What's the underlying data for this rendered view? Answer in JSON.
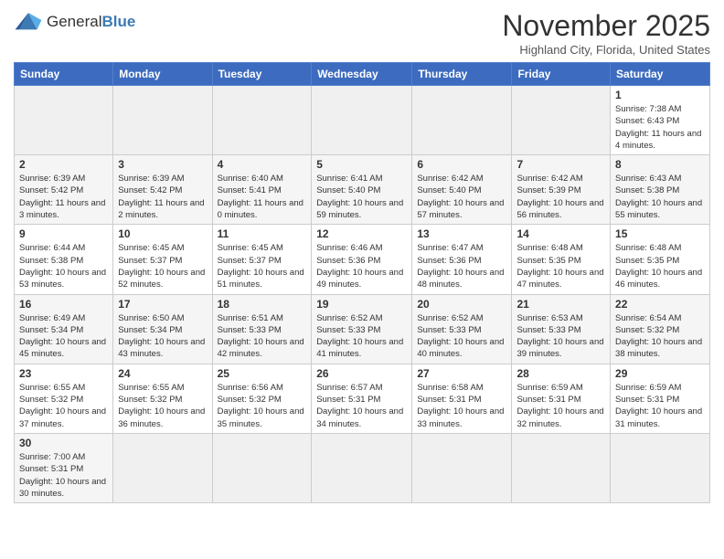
{
  "logo": {
    "text_general": "General",
    "text_blue": "Blue"
  },
  "header": {
    "month": "November 2025",
    "location": "Highland City, Florida, United States"
  },
  "weekdays": [
    "Sunday",
    "Monday",
    "Tuesday",
    "Wednesday",
    "Thursday",
    "Friday",
    "Saturday"
  ],
  "weeks": [
    [
      {
        "day": "",
        "info": ""
      },
      {
        "day": "",
        "info": ""
      },
      {
        "day": "",
        "info": ""
      },
      {
        "day": "",
        "info": ""
      },
      {
        "day": "",
        "info": ""
      },
      {
        "day": "",
        "info": ""
      },
      {
        "day": "1",
        "info": "Sunrise: 7:38 AM\nSunset: 6:43 PM\nDaylight: 11 hours and 4 minutes."
      }
    ],
    [
      {
        "day": "2",
        "info": "Sunrise: 6:39 AM\nSunset: 5:42 PM\nDaylight: 11 hours and 3 minutes."
      },
      {
        "day": "3",
        "info": "Sunrise: 6:39 AM\nSunset: 5:42 PM\nDaylight: 11 hours and 2 minutes."
      },
      {
        "day": "4",
        "info": "Sunrise: 6:40 AM\nSunset: 5:41 PM\nDaylight: 11 hours and 0 minutes."
      },
      {
        "day": "5",
        "info": "Sunrise: 6:41 AM\nSunset: 5:40 PM\nDaylight: 10 hours and 59 minutes."
      },
      {
        "day": "6",
        "info": "Sunrise: 6:42 AM\nSunset: 5:40 PM\nDaylight: 10 hours and 57 minutes."
      },
      {
        "day": "7",
        "info": "Sunrise: 6:42 AM\nSunset: 5:39 PM\nDaylight: 10 hours and 56 minutes."
      },
      {
        "day": "8",
        "info": "Sunrise: 6:43 AM\nSunset: 5:38 PM\nDaylight: 10 hours and 55 minutes."
      }
    ],
    [
      {
        "day": "9",
        "info": "Sunrise: 6:44 AM\nSunset: 5:38 PM\nDaylight: 10 hours and 53 minutes."
      },
      {
        "day": "10",
        "info": "Sunrise: 6:45 AM\nSunset: 5:37 PM\nDaylight: 10 hours and 52 minutes."
      },
      {
        "day": "11",
        "info": "Sunrise: 6:45 AM\nSunset: 5:37 PM\nDaylight: 10 hours and 51 minutes."
      },
      {
        "day": "12",
        "info": "Sunrise: 6:46 AM\nSunset: 5:36 PM\nDaylight: 10 hours and 49 minutes."
      },
      {
        "day": "13",
        "info": "Sunrise: 6:47 AM\nSunset: 5:36 PM\nDaylight: 10 hours and 48 minutes."
      },
      {
        "day": "14",
        "info": "Sunrise: 6:48 AM\nSunset: 5:35 PM\nDaylight: 10 hours and 47 minutes."
      },
      {
        "day": "15",
        "info": "Sunrise: 6:48 AM\nSunset: 5:35 PM\nDaylight: 10 hours and 46 minutes."
      }
    ],
    [
      {
        "day": "16",
        "info": "Sunrise: 6:49 AM\nSunset: 5:34 PM\nDaylight: 10 hours and 45 minutes."
      },
      {
        "day": "17",
        "info": "Sunrise: 6:50 AM\nSunset: 5:34 PM\nDaylight: 10 hours and 43 minutes."
      },
      {
        "day": "18",
        "info": "Sunrise: 6:51 AM\nSunset: 5:33 PM\nDaylight: 10 hours and 42 minutes."
      },
      {
        "day": "19",
        "info": "Sunrise: 6:52 AM\nSunset: 5:33 PM\nDaylight: 10 hours and 41 minutes."
      },
      {
        "day": "20",
        "info": "Sunrise: 6:52 AM\nSunset: 5:33 PM\nDaylight: 10 hours and 40 minutes."
      },
      {
        "day": "21",
        "info": "Sunrise: 6:53 AM\nSunset: 5:33 PM\nDaylight: 10 hours and 39 minutes."
      },
      {
        "day": "22",
        "info": "Sunrise: 6:54 AM\nSunset: 5:32 PM\nDaylight: 10 hours and 38 minutes."
      }
    ],
    [
      {
        "day": "23",
        "info": "Sunrise: 6:55 AM\nSunset: 5:32 PM\nDaylight: 10 hours and 37 minutes."
      },
      {
        "day": "24",
        "info": "Sunrise: 6:55 AM\nSunset: 5:32 PM\nDaylight: 10 hours and 36 minutes."
      },
      {
        "day": "25",
        "info": "Sunrise: 6:56 AM\nSunset: 5:32 PM\nDaylight: 10 hours and 35 minutes."
      },
      {
        "day": "26",
        "info": "Sunrise: 6:57 AM\nSunset: 5:31 PM\nDaylight: 10 hours and 34 minutes."
      },
      {
        "day": "27",
        "info": "Sunrise: 6:58 AM\nSunset: 5:31 PM\nDaylight: 10 hours and 33 minutes."
      },
      {
        "day": "28",
        "info": "Sunrise: 6:59 AM\nSunset: 5:31 PM\nDaylight: 10 hours and 32 minutes."
      },
      {
        "day": "29",
        "info": "Sunrise: 6:59 AM\nSunset: 5:31 PM\nDaylight: 10 hours and 31 minutes."
      }
    ],
    [
      {
        "day": "30",
        "info": "Sunrise: 7:00 AM\nSunset: 5:31 PM\nDaylight: 10 hours and 30 minutes."
      },
      {
        "day": "",
        "info": ""
      },
      {
        "day": "",
        "info": ""
      },
      {
        "day": "",
        "info": ""
      },
      {
        "day": "",
        "info": ""
      },
      {
        "day": "",
        "info": ""
      },
      {
        "day": "",
        "info": ""
      }
    ]
  ]
}
